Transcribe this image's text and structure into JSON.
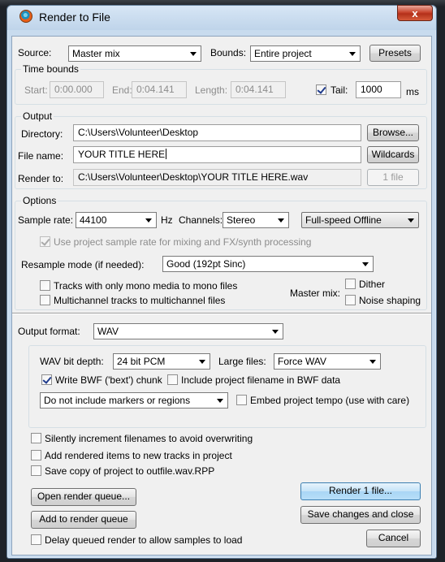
{
  "window": {
    "title": "Render to File",
    "close_glyph": "x"
  },
  "source": {
    "label": "Source:",
    "value": "Master mix"
  },
  "bounds": {
    "label": "Bounds:",
    "value": "Entire project"
  },
  "presets_label": "Presets",
  "time_bounds": {
    "legend": "Time bounds",
    "start_label": "Start:",
    "start_value": "0:00.000",
    "end_label": "End:",
    "end_value": "0:04.141",
    "length_label": "Length:",
    "length_value": "0:04.141",
    "tail_label": "Tail:",
    "tail_value": "1000",
    "tail_unit": "ms"
  },
  "output": {
    "legend": "Output",
    "directory_label": "Directory:",
    "directory_value": "C:\\Users\\Volunteer\\Desktop",
    "browse_label": "Browse...",
    "filename_label": "File name:",
    "filename_value": "YOUR TITLE HERE",
    "wildcards_label": "Wildcards",
    "render_to_label": "Render to:",
    "render_to_value": "C:\\Users\\Volunteer\\Desktop\\YOUR TITLE HERE.wav",
    "files_count_label": "1 file"
  },
  "options": {
    "legend": "Options",
    "sample_rate_label": "Sample rate:",
    "sample_rate_value": "44100",
    "hz_label": "Hz",
    "channels_label": "Channels:",
    "channels_value": "Stereo",
    "render_speed_value": "Full-speed Offline",
    "use_project_rate_label": "Use project sample rate for mixing and FX/synth processing",
    "resample_label": "Resample mode (if needed):",
    "resample_value": "Good (192pt Sinc)",
    "mono_tracks_label": "Tracks with only mono media to mono files",
    "multichannel_label": "Multichannel tracks to multichannel files",
    "master_mix_label": "Master mix:",
    "dither_label": "Dither",
    "noise_shaping_label": "Noise shaping"
  },
  "format": {
    "label": "Output format:",
    "value": "WAV",
    "bit_depth_label": "WAV bit depth:",
    "bit_depth_value": "24 bit PCM",
    "large_files_label": "Large files:",
    "large_files_value": "Force WAV",
    "bwf_label": "Write BWF ('bext') chunk",
    "include_filename_label": "Include project filename in BWF data",
    "markers_value": "Do not include markers or regions",
    "embed_tempo_label": "Embed project tempo (use with care)"
  },
  "misc": {
    "silently_increment_label": "Silently increment filenames to avoid overwriting",
    "add_rendered_label": "Add rendered items to new tracks in project",
    "save_copy_label": "Save copy of project to outfile.wav.RPP"
  },
  "actions": {
    "open_queue_label": "Open render queue...",
    "add_queue_label": "Add to render queue",
    "delay_label": "Delay queued render to allow samples to load",
    "render_label": "Render 1 file...",
    "save_close_label": "Save changes and close",
    "cancel_label": "Cancel"
  }
}
